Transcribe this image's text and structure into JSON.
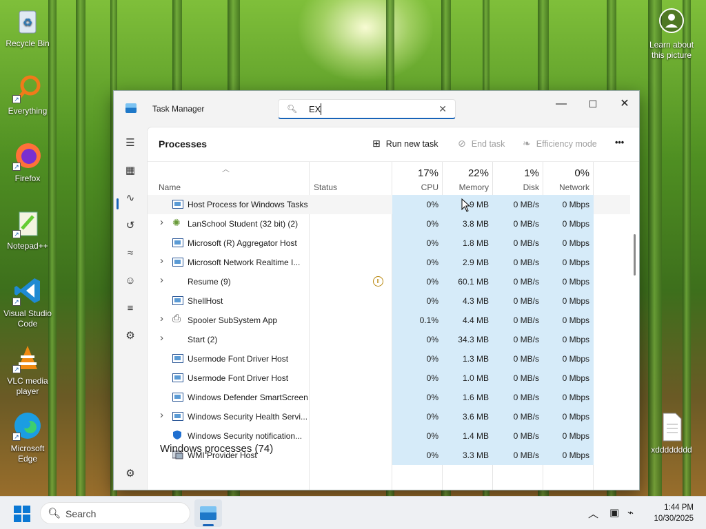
{
  "desktop": {
    "icons": [
      {
        "label": "Recycle Bin",
        "icon": "recycle-bin-icon"
      },
      {
        "label": "Everything",
        "icon": "everything-search-icon"
      },
      {
        "label": "Firefox",
        "icon": "firefox-icon"
      },
      {
        "label": "Notepad++",
        "icon": "notepad-plus-plus-icon"
      },
      {
        "label": "Visual Studio Code",
        "icon": "vscode-icon"
      },
      {
        "label": "VLC media player",
        "icon": "vlc-icon"
      },
      {
        "label": "Microsoft Edge",
        "icon": "edge-icon"
      }
    ],
    "learn_label": "Learn about this picture",
    "file_label": "xdddddddd"
  },
  "window": {
    "title": "Task Manager",
    "search_value": "EX",
    "minimize": "—",
    "maximize": "☐",
    "close": "✕"
  },
  "toolbar": {
    "page_title": "Processes",
    "run_new_task": "Run new task",
    "end_task": "End task",
    "efficiency_mode": "Efficiency mode",
    "more": "•••"
  },
  "columns": {
    "name": "Name",
    "status": "Status",
    "cpu_pct": "17%",
    "cpu": "CPU",
    "mem_pct": "22%",
    "memory": "Memory",
    "disk_pct": "1%",
    "disk": "Disk",
    "net_pct": "0%",
    "network": "Network"
  },
  "processes": [
    {
      "name": "Host Process for Windows Tasks",
      "expand": false,
      "icon": "window-app",
      "status": "",
      "cpu": "0%",
      "memory": "9 MB",
      "disk": "0 MB/s",
      "network": "0 Mbps",
      "highlight": true
    },
    {
      "name": "LanSchool Student (32 bit) (2)",
      "expand": true,
      "icon": "lanschool",
      "status": "",
      "cpu": "0%",
      "memory": "3.8 MB",
      "disk": "0 MB/s",
      "network": "0 Mbps"
    },
    {
      "name": "Microsoft (R) Aggregator Host",
      "expand": false,
      "icon": "window-app",
      "status": "",
      "cpu": "0%",
      "memory": "1.8 MB",
      "disk": "0 MB/s",
      "network": "0 Mbps"
    },
    {
      "name": "Microsoft Network Realtime I...",
      "expand": true,
      "icon": "window-app",
      "status": "",
      "cpu": "0%",
      "memory": "2.9 MB",
      "disk": "0 MB/s",
      "network": "0 Mbps"
    },
    {
      "name": "Resume (9)",
      "expand": true,
      "icon": "none",
      "status": "paused",
      "cpu": "0%",
      "memory": "60.1 MB",
      "disk": "0 MB/s",
      "network": "0 Mbps"
    },
    {
      "name": "ShellHost",
      "expand": false,
      "icon": "window-app",
      "status": "",
      "cpu": "0%",
      "memory": "4.3 MB",
      "disk": "0 MB/s",
      "network": "0 Mbps"
    },
    {
      "name": "Spooler SubSystem App",
      "expand": true,
      "icon": "printer",
      "status": "",
      "cpu": "0.1%",
      "memory": "4.4 MB",
      "disk": "0 MB/s",
      "network": "0 Mbps"
    },
    {
      "name": "Start (2)",
      "expand": true,
      "icon": "none",
      "status": "",
      "cpu": "0%",
      "memory": "34.3 MB",
      "disk": "0 MB/s",
      "network": "0 Mbps"
    },
    {
      "name": "Usermode Font Driver Host",
      "expand": false,
      "icon": "window-app",
      "status": "",
      "cpu": "0%",
      "memory": "1.3 MB",
      "disk": "0 MB/s",
      "network": "0 Mbps"
    },
    {
      "name": "Usermode Font Driver Host",
      "expand": false,
      "icon": "window-app",
      "status": "",
      "cpu": "0%",
      "memory": "1.0 MB",
      "disk": "0 MB/s",
      "network": "0 Mbps"
    },
    {
      "name": "Windows Defender SmartScreen",
      "expand": false,
      "icon": "window-app",
      "status": "",
      "cpu": "0%",
      "memory": "1.6 MB",
      "disk": "0 MB/s",
      "network": "0 Mbps"
    },
    {
      "name": "Windows Security Health Servi...",
      "expand": true,
      "icon": "window-app",
      "status": "",
      "cpu": "0%",
      "memory": "3.6 MB",
      "disk": "0 MB/s",
      "network": "0 Mbps"
    },
    {
      "name": "Windows Security notification...",
      "expand": false,
      "icon": "shield",
      "status": "",
      "cpu": "0%",
      "memory": "1.4 MB",
      "disk": "0 MB/s",
      "network": "0 Mbps"
    },
    {
      "name": "WMI Provider Host",
      "expand": false,
      "icon": "wmi",
      "status": "",
      "cpu": "0%",
      "memory": "3.3 MB",
      "disk": "0 MB/s",
      "network": "0 Mbps"
    }
  ],
  "section_title": "Windows processes (74)",
  "taskbar": {
    "search_label": "Search",
    "time": "1:44 PM",
    "date": "10/30/2025"
  },
  "colors": {
    "accent": "#1763b8",
    "highlight_cell": "#d6ebf9",
    "paused": "#b8860b"
  }
}
